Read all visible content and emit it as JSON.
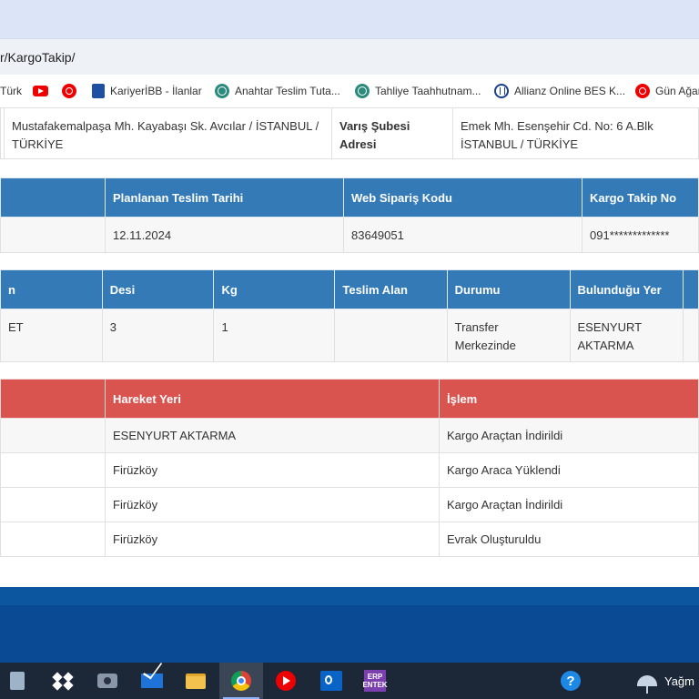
{
  "browser": {
    "url": "r/KargoTakip/",
    "bookmarks": [
      {
        "label": "Türk",
        "icon": "none"
      },
      {
        "label": "",
        "icon": "youtube-icon"
      },
      {
        "label": "",
        "icon": "youtube-music-icon"
      },
      {
        "label": "KariyerİBB - İlanlar",
        "icon": "ibb-icon"
      },
      {
        "label": "Anahtar Teslim Tuta...",
        "icon": "globe-icon"
      },
      {
        "label": "Tahliye Taahhutnam...",
        "icon": "globe-icon"
      },
      {
        "label": "Allianz Online BES K...",
        "icon": "allianz-icon"
      },
      {
        "label": "Gün Ağar",
        "icon": "youtube-music-icon"
      }
    ]
  },
  "address": {
    "sender_address": "Mustafakemalpaşa Mh. Kayabaşı Sk. Avcılar / İSTANBUL / TÜRKİYE",
    "arrival_branch_label": "Varış Şubesi Adresi",
    "arrival_branch_address": "Emek Mh. Esenşehir Cd. No: 6 A.Blk İSTANBUL / TÜRKİYE"
  },
  "shipment": {
    "headers": [
      "",
      "Planlanan Teslim Tarihi",
      "Web Sipariş Kodu",
      "Kargo Takip No"
    ],
    "values": [
      "",
      "12.11.2024",
      "83649051",
      "091*************"
    ]
  },
  "details": {
    "headers": [
      "n",
      "Desi",
      "Kg",
      "Teslim Alan",
      "Durumu",
      "Bulunduğu Yer",
      ""
    ],
    "values": [
      "ET",
      "3",
      "1",
      "",
      "Transfer Merkezinde",
      "ESENYURT AKTARMA",
      ""
    ]
  },
  "movements": {
    "headers": [
      "",
      "Hareket Yeri",
      "İşlem"
    ],
    "rows": [
      {
        "date": "",
        "place": "ESENYURT AKTARMA",
        "action": "Kargo Araçtan İndirildi"
      },
      {
        "date": "",
        "place": "Firüzköy",
        "action": "Kargo Araca Yüklendi"
      },
      {
        "date": "",
        "place": "Firüzköy",
        "action": "Kargo Araçtan İndirildi"
      },
      {
        "date": "",
        "place": "Firüzköy",
        "action": "Evrak Oluşturuldu"
      }
    ]
  },
  "taskbar": {
    "apps": [
      "calculator-icon",
      "dropbox-icon",
      "camera-icon",
      "mail-icon",
      "file-explorer-icon",
      "chrome-icon",
      "youtube-music-icon",
      "outlook-icon",
      "erp-icon",
      "help-icon"
    ],
    "erp_label": "ERP ENTEK",
    "help_label": "?",
    "weather_text": "Yağm"
  },
  "colors": {
    "blue_header": "#337ab7",
    "red_header": "#d9534f",
    "footer": "#0a4a94",
    "taskbar": "#1c2838"
  }
}
